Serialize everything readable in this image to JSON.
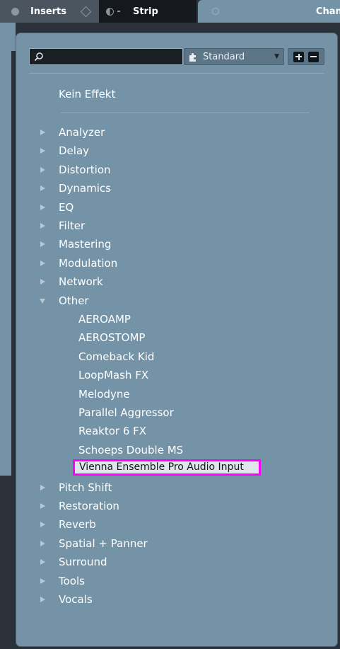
{
  "tabs": {
    "inserts": "Inserts",
    "strip": "Strip",
    "channel": "Chann"
  },
  "search": {
    "value": "",
    "placeholder": ""
  },
  "preset": {
    "label": "Standard"
  },
  "menu": {
    "no_effect": "Kein Effekt",
    "categories_before": [
      "Analyzer",
      "Delay",
      "Distortion",
      "Dynamics",
      "EQ",
      "Filter",
      "Mastering",
      "Modulation",
      "Network"
    ],
    "expanded_category": "Other",
    "other_items": [
      "AEROAMP",
      "AEROSTOMP",
      "Comeback Kid",
      "LoopMash FX",
      "Melodyne",
      "Parallel Aggressor",
      "Reaktor 6 FX",
      "Schoeps Double MS"
    ],
    "selected_item": "Vienna Ensemble Pro Audio Input",
    "categories_after": [
      "Pitch Shift",
      "Restoration",
      "Reverb",
      "Spatial + Panner",
      "Surround",
      "Tools",
      "Vocals"
    ]
  },
  "colors": {
    "highlight_border": "#ff00ff",
    "panel_bg": "#7493a6",
    "dark_bg": "#2b3138"
  },
  "icons": [
    "search-icon",
    "puzzle-icon",
    "dropdown-arrow-icon",
    "expand-all-icon",
    "collapse-all-icon",
    "disclosure-triangle-icon"
  ]
}
